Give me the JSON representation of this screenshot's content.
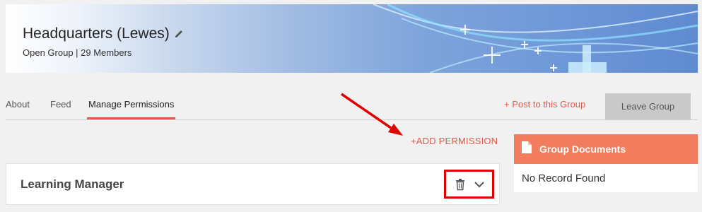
{
  "group": {
    "title": "Headquarters (Lewes)",
    "meta": "Open Group | 29 Members"
  },
  "tabs": [
    {
      "label": "About"
    },
    {
      "label": "Feed"
    },
    {
      "label": "Manage Permissions"
    }
  ],
  "active_tab": "Manage Permissions",
  "actions": {
    "post_link": "+ Post to this Group",
    "leave_button": "Leave Group",
    "add_permission": "+ADD PERMISSION"
  },
  "permissions": [
    {
      "name": "Learning Manager"
    }
  ],
  "documents": {
    "title": "Group Documents",
    "empty_text": "No Record Found"
  },
  "colors": {
    "accent": "#e4574a",
    "docs_header": "#f27c5e",
    "annotation": "#e00000",
    "leave_button_bg": "#c9c9c9"
  },
  "icons": [
    "pencil-icon",
    "trash-icon",
    "chevron-down-icon",
    "document-icon"
  ]
}
